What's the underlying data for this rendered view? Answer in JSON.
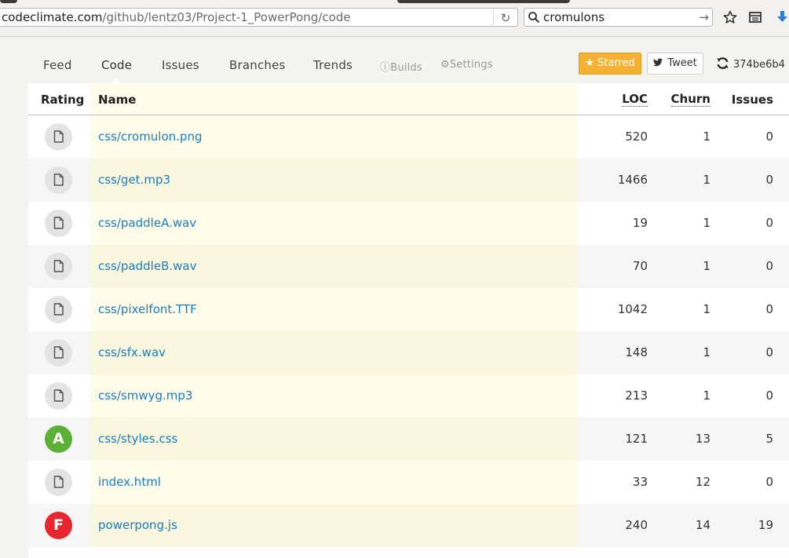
{
  "browser": {
    "url_host": "codeclimate.com",
    "url_path": "/github/lentz03/Project-1_PowerPong/code",
    "search_value": "cromulons"
  },
  "nav": {
    "feed": "Feed",
    "code": "Code",
    "issues": "Issues",
    "branches": "Branches",
    "trends": "Trends",
    "builds": "Builds",
    "settings": "Settings"
  },
  "actions": {
    "starred": "Starred",
    "tweet": "Tweet",
    "commit": "374be6b4"
  },
  "table": {
    "headers": {
      "rating": "Rating",
      "name": "Name",
      "loc": "LOC",
      "churn": "Churn",
      "issues": "Issues"
    },
    "rows": [
      {
        "grade": "",
        "name": "css/cromulon.png",
        "loc": "520",
        "churn": "1",
        "issues": "0"
      },
      {
        "grade": "",
        "name": "css/get.mp3",
        "loc": "1466",
        "churn": "1",
        "issues": "0"
      },
      {
        "grade": "",
        "name": "css/paddleA.wav",
        "loc": "19",
        "churn": "1",
        "issues": "0"
      },
      {
        "grade": "",
        "name": "css/paddleB.wav",
        "loc": "70",
        "churn": "1",
        "issues": "0"
      },
      {
        "grade": "",
        "name": "css/pixelfont.TTF",
        "loc": "1042",
        "churn": "1",
        "issues": "0"
      },
      {
        "grade": "",
        "name": "css/sfx.wav",
        "loc": "148",
        "churn": "1",
        "issues": "0"
      },
      {
        "grade": "",
        "name": "css/smwyg.mp3",
        "loc": "213",
        "churn": "1",
        "issues": "0"
      },
      {
        "grade": "A",
        "name": "css/styles.css",
        "loc": "121",
        "churn": "13",
        "issues": "5"
      },
      {
        "grade": "",
        "name": "index.html",
        "loc": "33",
        "churn": "12",
        "issues": "0"
      },
      {
        "grade": "F",
        "name": "powerpong.js",
        "loc": "240",
        "churn": "14",
        "issues": "19"
      }
    ]
  },
  "colors": {
    "grade_a": "#5cb038",
    "grade_f": "#e8262f",
    "link": "#1a7dc4",
    "starred_bg": "#f7b233"
  }
}
